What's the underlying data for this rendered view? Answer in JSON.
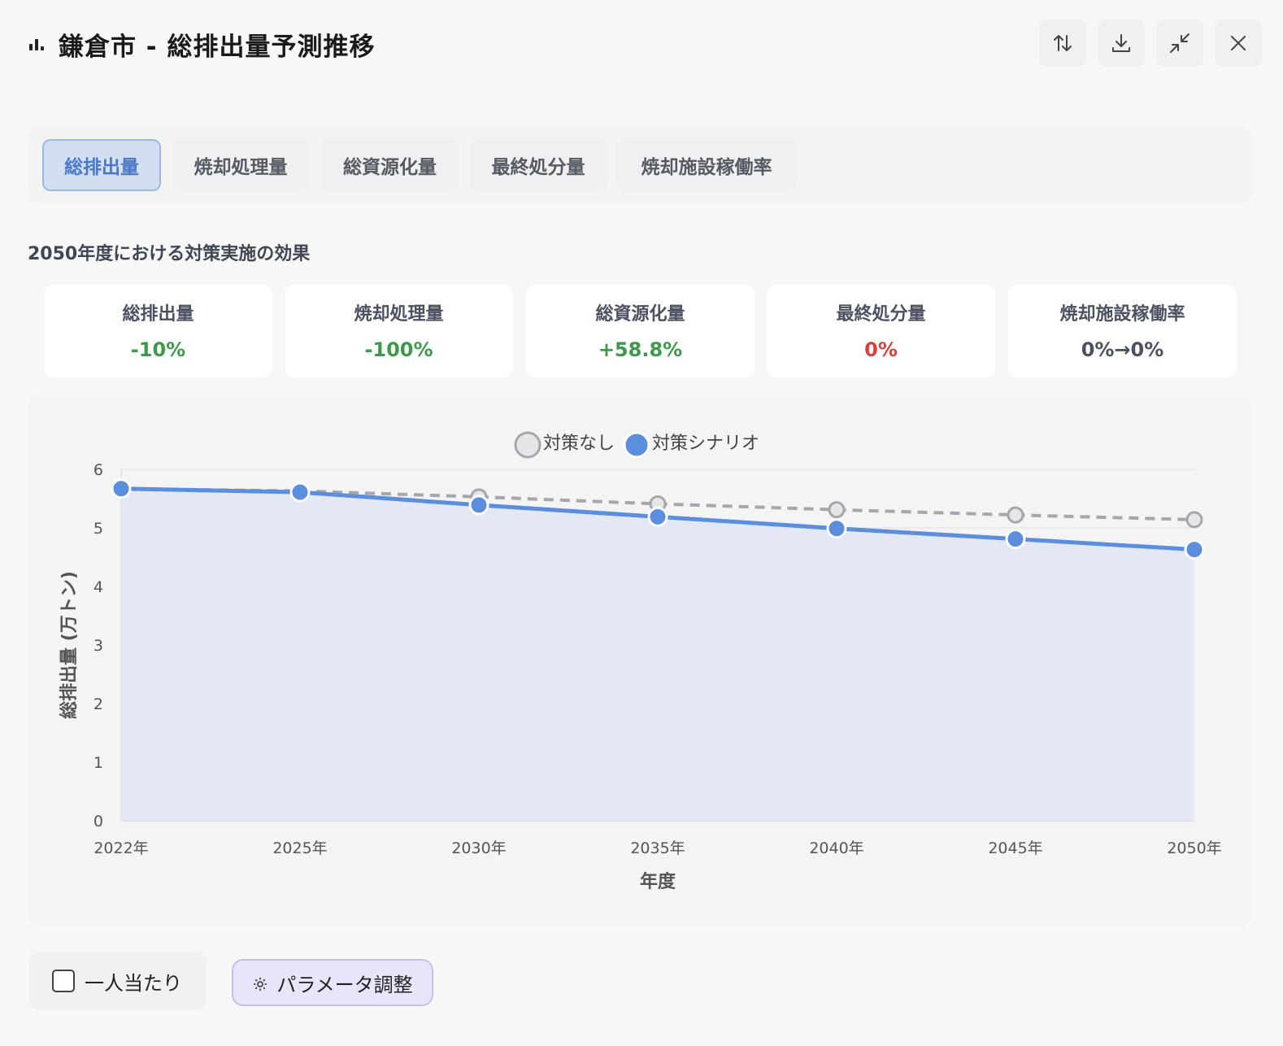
{
  "header": {
    "title": "鎌倉市 - 総排出量予測推移"
  },
  "tabs": [
    {
      "label": "総排出量",
      "active": true
    },
    {
      "label": "焼却処理量",
      "active": false
    },
    {
      "label": "総資源化量",
      "active": false
    },
    {
      "label": "最終処分量",
      "active": false
    },
    {
      "label": "焼却施設稼働率",
      "active": false
    }
  ],
  "effects": {
    "heading": "2050年度における対策実施の効果",
    "cards": [
      {
        "label": "総排出量",
        "value": "-10%",
        "tone": "green"
      },
      {
        "label": "焼却処理量",
        "value": "-100%",
        "tone": "green"
      },
      {
        "label": "総資源化量",
        "value": "+58.8%",
        "tone": "green"
      },
      {
        "label": "最終処分量",
        "value": "0%",
        "tone": "red"
      },
      {
        "label": "焼却施設稼働率",
        "value": "0%→0%",
        "tone": "gray"
      }
    ]
  },
  "chart_data": {
    "type": "line",
    "categories": [
      "2022年",
      "2025年",
      "2030年",
      "2035年",
      "2040年",
      "2045年",
      "2050年"
    ],
    "series": [
      {
        "name": "対策なし",
        "values": [
          5.67,
          5.63,
          5.53,
          5.41,
          5.31,
          5.22,
          5.14
        ],
        "color": "#a6a7ad",
        "style": "dashed"
      },
      {
        "name": "対策シナリオ",
        "values": [
          5.67,
          5.61,
          5.39,
          5.19,
          4.99,
          4.81,
          4.63
        ],
        "color": "#5b8fde",
        "style": "solid",
        "fill": true
      }
    ],
    "xlabel": "年度",
    "ylabel": "総排出量 (万トン)",
    "ylim": [
      0,
      6
    ],
    "yticks": [
      "0",
      "1",
      "2",
      "3",
      "4",
      "5",
      "6"
    ],
    "grid": true,
    "legend": "top-center"
  },
  "footer": {
    "per_capita_label": "一人当たり",
    "param_button_label": "パラメータ調整"
  },
  "colors": {
    "accent": "#5b8fde",
    "positive": "#3c9a4a",
    "negative": "#d9423b"
  }
}
